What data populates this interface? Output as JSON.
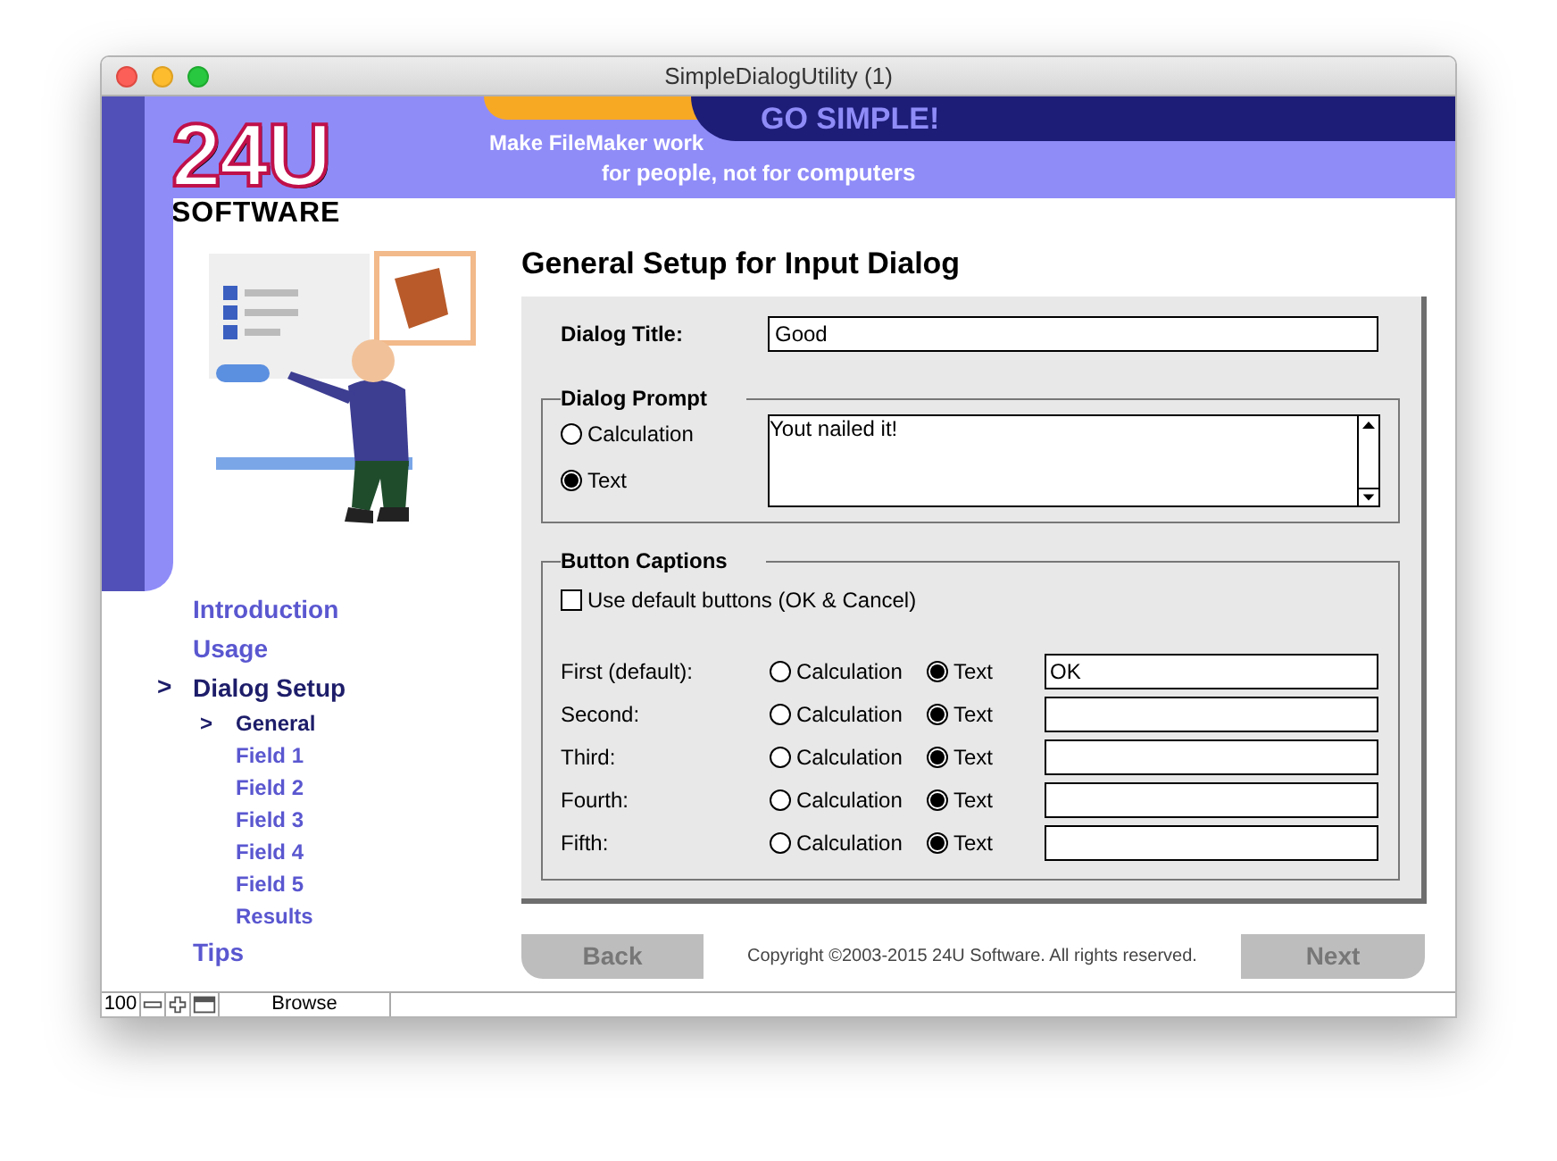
{
  "window": {
    "title": "SimpleDialogUtility (1)"
  },
  "logo": {
    "mark": "24U",
    "wordmark": "SOFTWARE"
  },
  "banner": {
    "slogan": "GO SIMPLE!",
    "tagline_1": "Make FileMaker work",
    "tagline_2": "for **people**, not for **computers**"
  },
  "nav": {
    "items": [
      {
        "label": "Introduction",
        "selected": false
      },
      {
        "label": "Usage",
        "selected": false
      },
      {
        "label": "Dialog Setup",
        "selected": true,
        "marker": ">",
        "children": [
          {
            "label": "General",
            "selected": true,
            "marker": ">"
          },
          {
            "label": "Field 1",
            "selected": false
          },
          {
            "label": "Field 2",
            "selected": false
          },
          {
            "label": "Field 3",
            "selected": false
          },
          {
            "label": "Field 4",
            "selected": false
          },
          {
            "label": "Field 5",
            "selected": false
          },
          {
            "label": "Results",
            "selected": false
          }
        ]
      },
      {
        "label": "Tips",
        "selected": false
      }
    ]
  },
  "page_title": "General Setup for Input Dialog",
  "dialog_title": {
    "label": "Dialog Title:",
    "value": "Good"
  },
  "dialog_prompt": {
    "legend": "Dialog Prompt",
    "options": [
      {
        "label": "Calculation",
        "selected": false
      },
      {
        "label": "Text",
        "selected": true
      }
    ],
    "value": "Yout nailed it!"
  },
  "button_captions": {
    "legend": "Button Captions",
    "use_default": {
      "label": "Use default buttons (OK & Cancel)",
      "checked": false
    },
    "rows": [
      {
        "label": "First (default):",
        "options": [
          {
            "label": "Calculation",
            "selected": false
          },
          {
            "label": "Text",
            "selected": true
          }
        ],
        "value": "OK"
      },
      {
        "label": "Second:",
        "options": [
          {
            "label": "Calculation",
            "selected": false
          },
          {
            "label": "Text",
            "selected": true
          }
        ]
      },
      {
        "label": "Third:",
        "options": [
          {
            "label": "Calculation",
            "selected": false
          },
          {
            "label": "Text",
            "selected": true
          }
        ]
      },
      {
        "label": "Fourth:",
        "options": [
          {
            "label": "Calculation",
            "selected": false
          },
          {
            "label": "Text",
            "selected": true
          }
        ]
      },
      {
        "label": "Fifth:",
        "options": [
          {
            "label": "Calculation",
            "selected": false
          },
          {
            "label": "Text",
            "selected": true
          }
        ]
      }
    ]
  },
  "footer": {
    "back": "Back",
    "copyright": "Copyright ©2003-2015 24U Software. All rights reserved.",
    "next": "Next"
  },
  "status_bar": {
    "zoom": "100",
    "mode": "Browse"
  }
}
